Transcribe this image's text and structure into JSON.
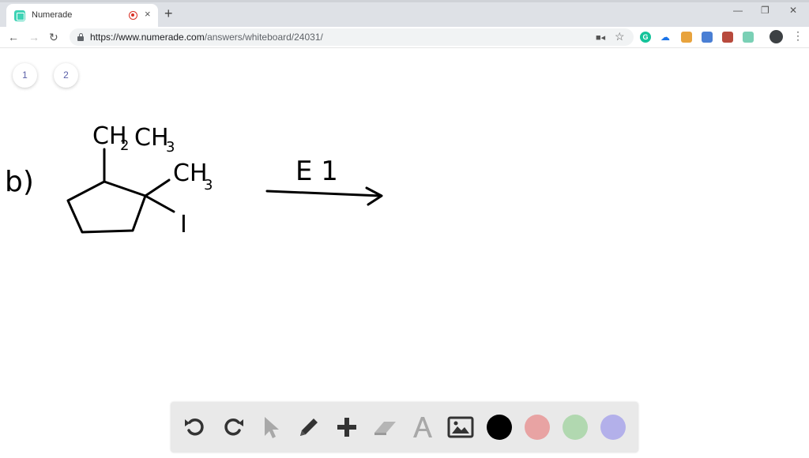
{
  "browser": {
    "tab_title": "Numerade",
    "tab_close": "×",
    "new_tab": "+",
    "url_host": "https://www.numerade.com",
    "url_path": "/answers/whiteboard/24031/",
    "window_minimize": "—",
    "window_restore": "❐",
    "window_close": "✕"
  },
  "pages": [
    {
      "label": "1"
    },
    {
      "label": "2"
    }
  ],
  "whiteboard": {
    "part_label": "b)",
    "substituent_top": "CH",
    "substituent_top_sub": "2",
    "substituent_top_rest": "CH",
    "substituent_top_rest_sub": "3",
    "substituent_right": "CH",
    "substituent_right_sub": "3",
    "leaving_group": "I",
    "reaction_condition": "E 1"
  },
  "tools": {
    "colors": {
      "black": "#000000",
      "red": "#e8a3a3",
      "green": "#b1d8b0",
      "blue": "#b3b0ea"
    }
  }
}
